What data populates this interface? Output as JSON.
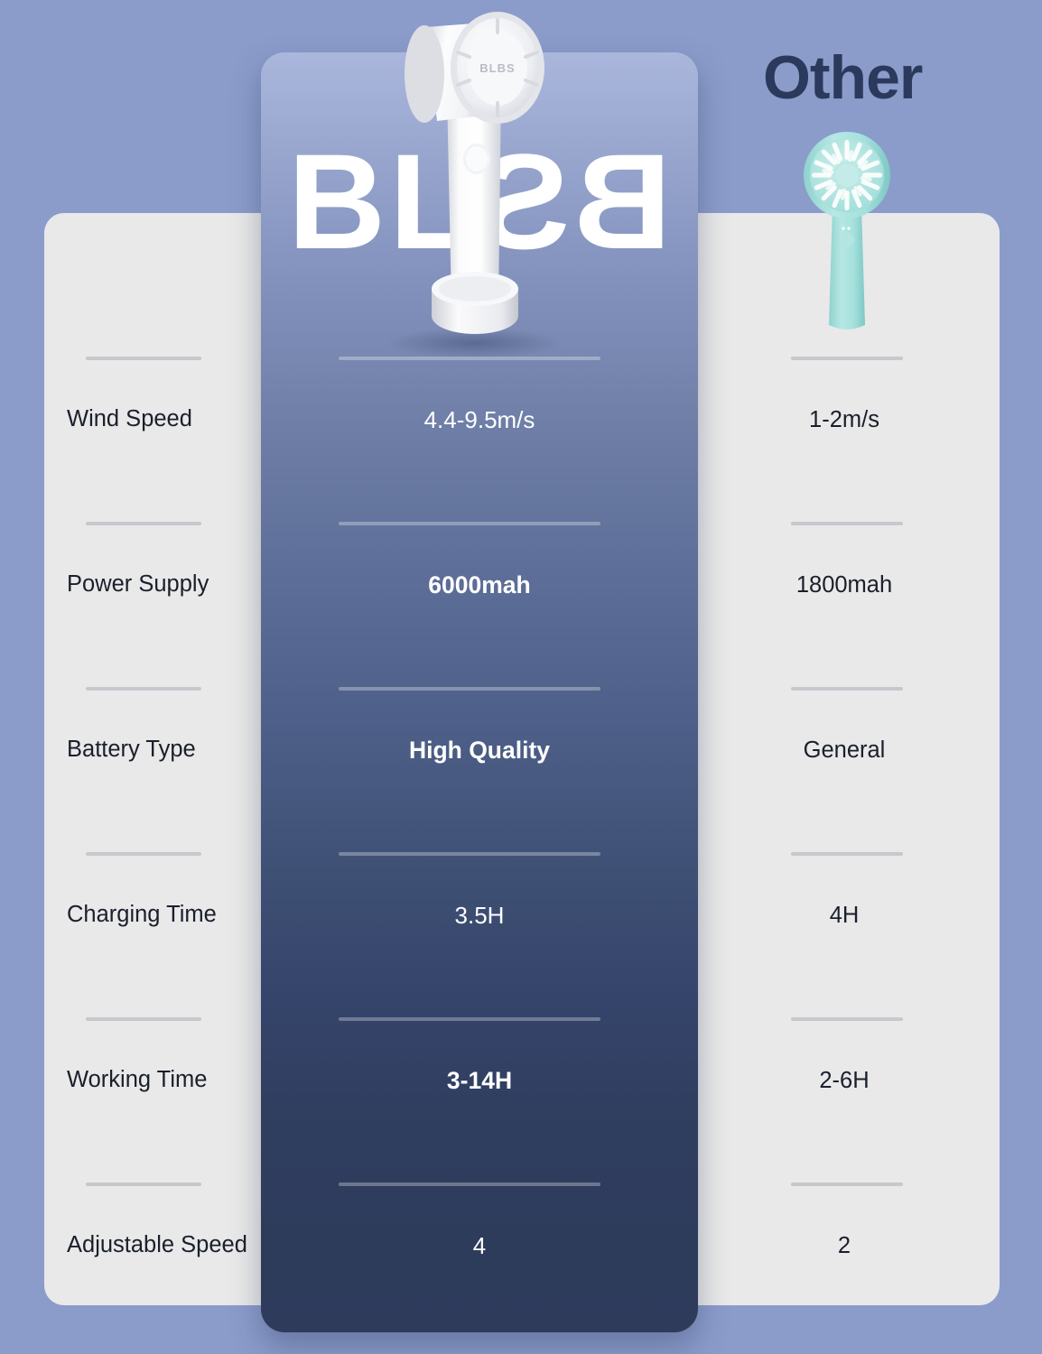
{
  "background_color": "#8b9ccb",
  "card_color": "#e9e9e9",
  "brand": {
    "name": "BLBS",
    "wordmark_part_1": "BL",
    "wordmark_part_2": "BS"
  },
  "competitor": {
    "title": "Other",
    "title_color": "#2b3a5c"
  },
  "comparison": {
    "rows": [
      {
        "label": "Wind Speed",
        "brand_value": "4.4-9.5m/s",
        "other_value": "1-2m/s",
        "brand_bold": false
      },
      {
        "label": "Power Supply",
        "brand_value": "6000mah",
        "other_value": "1800mah",
        "brand_bold": true
      },
      {
        "label": "Battery Type",
        "brand_value": "High Quality",
        "other_value": "General",
        "brand_bold": true
      },
      {
        "label": "Charging Time",
        "brand_value": "3.5H",
        "other_value": "4H",
        "brand_bold": false
      },
      {
        "label": "Working Time",
        "brand_value": "3-14H",
        "other_value": "2-6H",
        "brand_bold": true
      },
      {
        "label": "Adjustable Speed",
        "brand_value": "4",
        "other_value": "2",
        "brand_bold": false
      }
    ]
  },
  "products": {
    "brand_fan": {
      "icon": "handheld-turbine-fan-white",
      "body_color": "#ffffff",
      "logo_text": "BLBS"
    },
    "other_fan": {
      "icon": "handheld-blade-fan-mint",
      "body_color": "#a9e0dd"
    }
  }
}
